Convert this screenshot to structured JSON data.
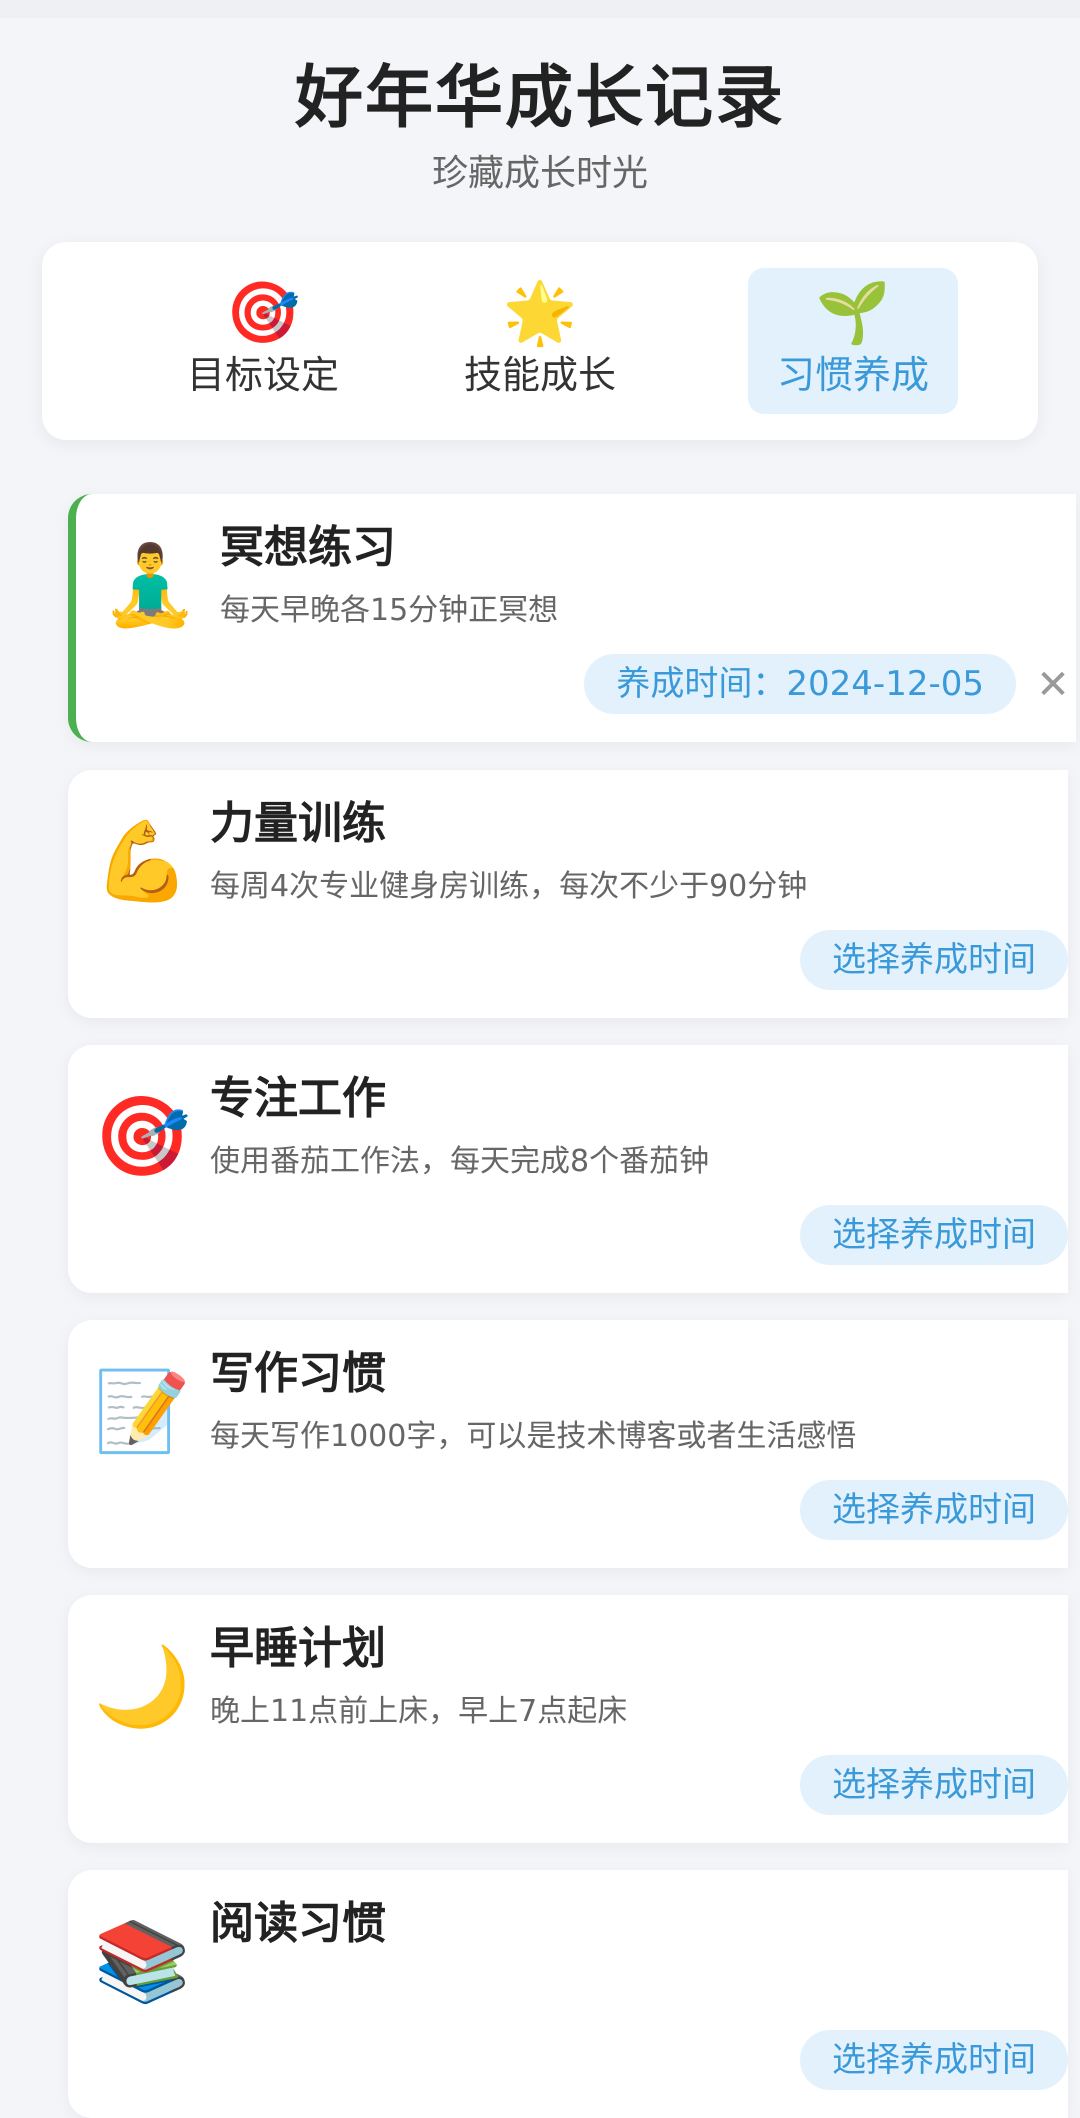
{
  "header": {
    "title": "好年华成长记录",
    "subtitle": "珍藏成长时光"
  },
  "tabs": [
    {
      "icon": "🎯",
      "label": "目标设定",
      "active": false
    },
    {
      "icon": "🌟",
      "label": "技能成长",
      "active": false
    },
    {
      "icon": "🌱",
      "label": "习惯养成",
      "active": true
    }
  ],
  "habits": [
    {
      "icon": "🧘‍♂️",
      "title": "冥想练习",
      "desc": "每天早晚各15分钟正冥想",
      "date_text": "养成时间：2024-12-05"
    },
    {
      "icon": "💪",
      "title": "力量训练",
      "desc": "每周4次专业健身房训练，每次不少于90分钟",
      "button": "选择养成时间"
    },
    {
      "icon": "🎯",
      "title": "专注工作",
      "desc": "使用番茄工作法，每天完成8个番茄钟",
      "button": "选择养成时间"
    },
    {
      "icon": "📝",
      "title": "写作习惯",
      "desc": "每天写作1000字，可以是技术博客或者生活感悟",
      "button": "选择养成时间"
    },
    {
      "icon": "🌙",
      "title": "早睡计划",
      "desc": "晚上11点前上床，早上7点起床",
      "button": "选择养成时间"
    },
    {
      "icon": "📚",
      "title": "阅读习惯",
      "desc": "",
      "button": "选择养成时间"
    }
  ],
  "colors": {
    "accent": "#3a9ad9",
    "active_border": "#4caf50",
    "pill_bg": "#e3f1fc"
  },
  "icons": {
    "close": "close-icon"
  }
}
